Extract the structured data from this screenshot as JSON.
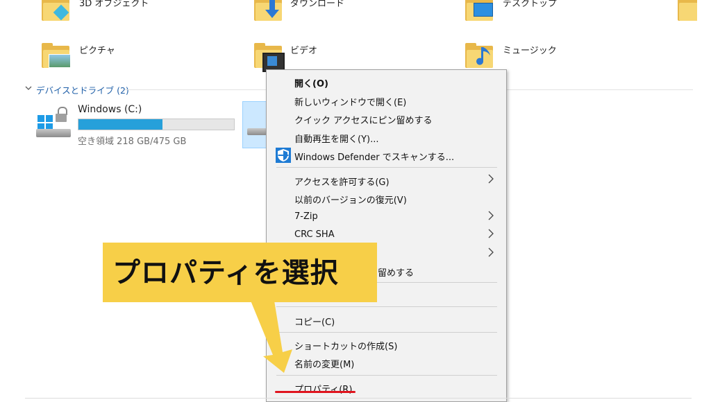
{
  "folders": {
    "objects3d": "3D オブジェクト",
    "downloads": "ダウンロード",
    "desktop": "デスクトップ",
    "pictures": "ピクチャ",
    "videos": "ビデオ",
    "music": "ミュージック"
  },
  "devices_section": {
    "header": "デバイスとドライブ (2)"
  },
  "drive_c": {
    "name": "Windows (C:)",
    "free_text": "空き領域 218 GB/475 GB",
    "used_fraction": 0.54,
    "bar_color": "#26a0da"
  },
  "context_menu": {
    "open": "開く(O)",
    "open_new_window": "新しいウィンドウで開く(E)",
    "pin_quick_access": "クイック アクセスにピン留めする",
    "autoplay": "自動再生を開く(Y)...",
    "defender_scan": "Windows Defender でスキャンする...",
    "give_access": "アクセスを許可する(G)",
    "restore_versions": "以前のバージョンの復元(V)",
    "seven_zip": "7-Zip",
    "crc_sha": "CRC SHA",
    "pin_start_partial": "留めする",
    "copy": "コピー(C)",
    "create_shortcut": "ショートカットの作成(S)",
    "rename": "名前の変更(M)",
    "properties": "プロパティ(R)"
  },
  "callout": {
    "text": "プロパティを選択",
    "color": "#f7cf48"
  },
  "accent_red": "#e0141e"
}
